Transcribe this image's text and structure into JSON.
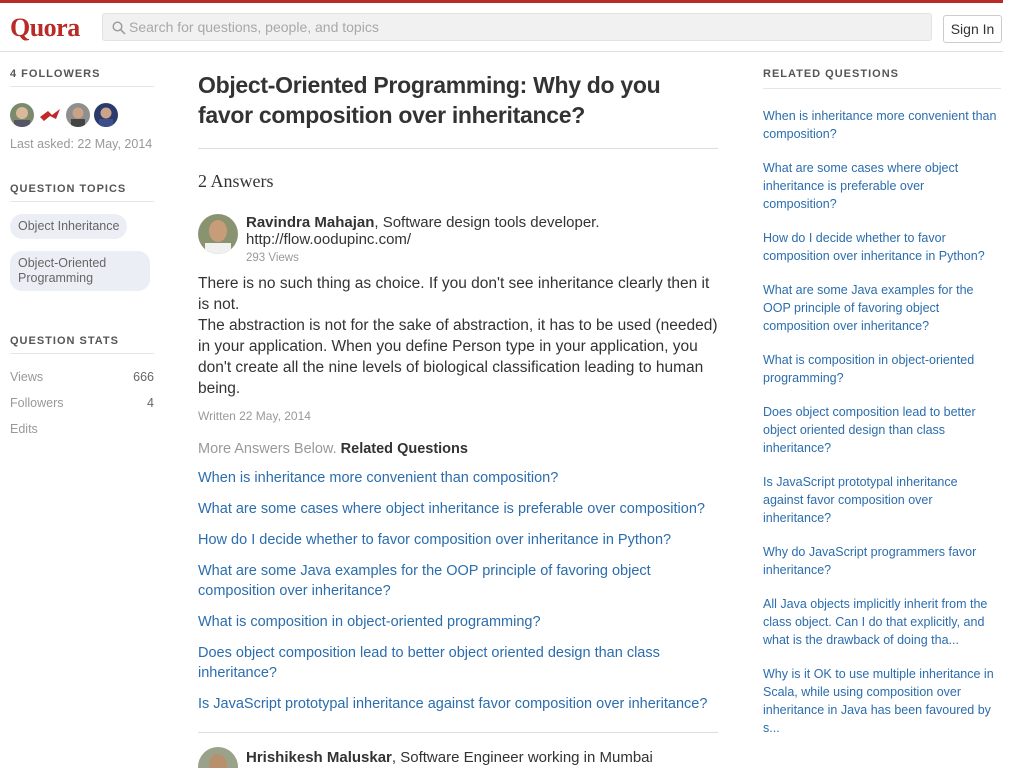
{
  "header": {
    "logo": "Quora",
    "search_placeholder": "Search for questions, people, and topics",
    "signin_label": "Sign In"
  },
  "left": {
    "followers_title": "4 FOLLOWERS",
    "last_asked": "Last asked: 22 May, 2014",
    "topics_title": "QUESTION TOPICS",
    "topics": [
      "Object Inheritance",
      "Object-Oriented Programming"
    ],
    "stats_title": "QUESTION STATS",
    "stats": [
      {
        "label": "Views",
        "value": "666"
      },
      {
        "label": "Followers",
        "value": "4"
      },
      {
        "label": "Edits",
        "value": ""
      }
    ]
  },
  "main": {
    "question_title": "Object-Oriented Programming: Why do you favor composition over inheritance?",
    "answers_count": "2 Answers",
    "answer1": {
      "author": "Ravindra Mahajan",
      "credential": ", Software design tools developer. http://flow.oodupinc.com/",
      "views": "293 Views",
      "text_p1": "There is no such thing as choice. If you don't see inheritance clearly then it is not.",
      "text_p2": "The abstraction is not for the sake of abstraction, it has to be used (needed) in your application. When you define Person type in your application, you don't create all the nine levels of biological classification leading to human being.",
      "written": "Written 22 May, 2014"
    },
    "more_answers": "More Answers Below.",
    "related_label": "Related Questions",
    "related_questions": [
      "When is inheritance more convenient than composition?",
      "What are some cases where object inheritance is preferable over composition?",
      "How do I decide whether to favor composition over inheritance in Python?",
      "What are some Java examples for the OOP principle of favoring object composition over inheritance?",
      "What is composition in object-oriented programming?",
      "Does object composition lead to better object oriented design than class inheritance?",
      "Is JavaScript prototypal inheritance against favor composition over inheritance?"
    ],
    "answer2": {
      "author": "Hrishikesh Maluskar",
      "credential": ", Software Engineer working in Mumbai"
    }
  },
  "right": {
    "title": "RELATED QUESTIONS",
    "questions": [
      "When is inheritance more convenient than composition?",
      "What are some cases where object inheritance is preferable over composition?",
      "How do I decide whether to favor composition over inheritance in Python?",
      "What are some Java examples for the OOP principle of favoring object composition over inheritance?",
      "What is composition in object-oriented programming?",
      "Does object composition lead to better object oriented design than class inheritance?",
      "Is JavaScript prototypal inheritance against favor composition over inheritance?",
      "Why do JavaScript programmers favor inheritance?",
      "All Java objects implicitly inherit from the class object. Can I do that explicitly, and what is the drawback of doing tha...",
      "Why is it OK to use multiple inheritance in Scala, while using composition over inheritance in Java has been favoured by s..."
    ]
  },
  "colors": {
    "brand": "#b92b27",
    "link": "#2b6dad",
    "muted": "#999999",
    "topic_bg": "#ebeef5"
  }
}
